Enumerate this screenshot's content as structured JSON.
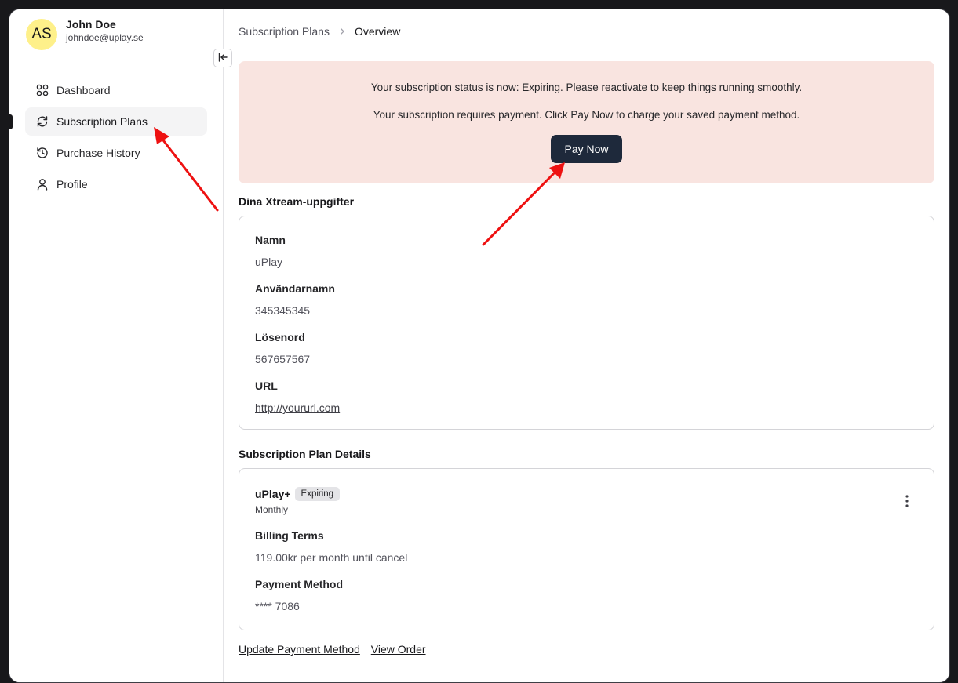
{
  "user": {
    "initials": "AS",
    "name": "John Doe",
    "email": "johndoe@uplay.se"
  },
  "sidebar": {
    "items": [
      {
        "label": "Dashboard",
        "icon": "grid-icon"
      },
      {
        "label": "Subscription Plans",
        "icon": "refresh-icon",
        "active": true
      },
      {
        "label": "Purchase History",
        "icon": "history-icon"
      },
      {
        "label": "Profile",
        "icon": "user-icon"
      }
    ]
  },
  "breadcrumb": {
    "parent": "Subscription Plans",
    "current": "Overview"
  },
  "alert": {
    "line1": "Your subscription status is now: Expiring. Please reactivate to keep things running smoothly.",
    "line2": "Your subscription requires payment. Click Pay Now to charge your saved payment method.",
    "button": "Pay Now"
  },
  "xtream": {
    "title": "Dina Xtream-uppgifter",
    "fields": [
      {
        "label": "Namn",
        "value": "uPlay"
      },
      {
        "label": "Användarnamn",
        "value": "345345345"
      },
      {
        "label": "Lösenord",
        "value": "567657567"
      },
      {
        "label": "URL",
        "value": "http://yoururl.com"
      }
    ]
  },
  "plan": {
    "title": "Subscription Plan Details",
    "name": "uPlay+",
    "status": "Expiring",
    "cycle": "Monthly",
    "billing_label": "Billing Terms",
    "billing_value": "119.00kr per month until cancel",
    "payment_label": "Payment Method",
    "payment_value": "**** 7086"
  },
  "links": {
    "update_payment": "Update Payment Method",
    "view_order": "View Order"
  },
  "colors": {
    "alert_bg": "#f9e4e0",
    "button_bg": "#1e293b",
    "avatar_bg": "#fef08a",
    "arrow": "#ee1111"
  }
}
